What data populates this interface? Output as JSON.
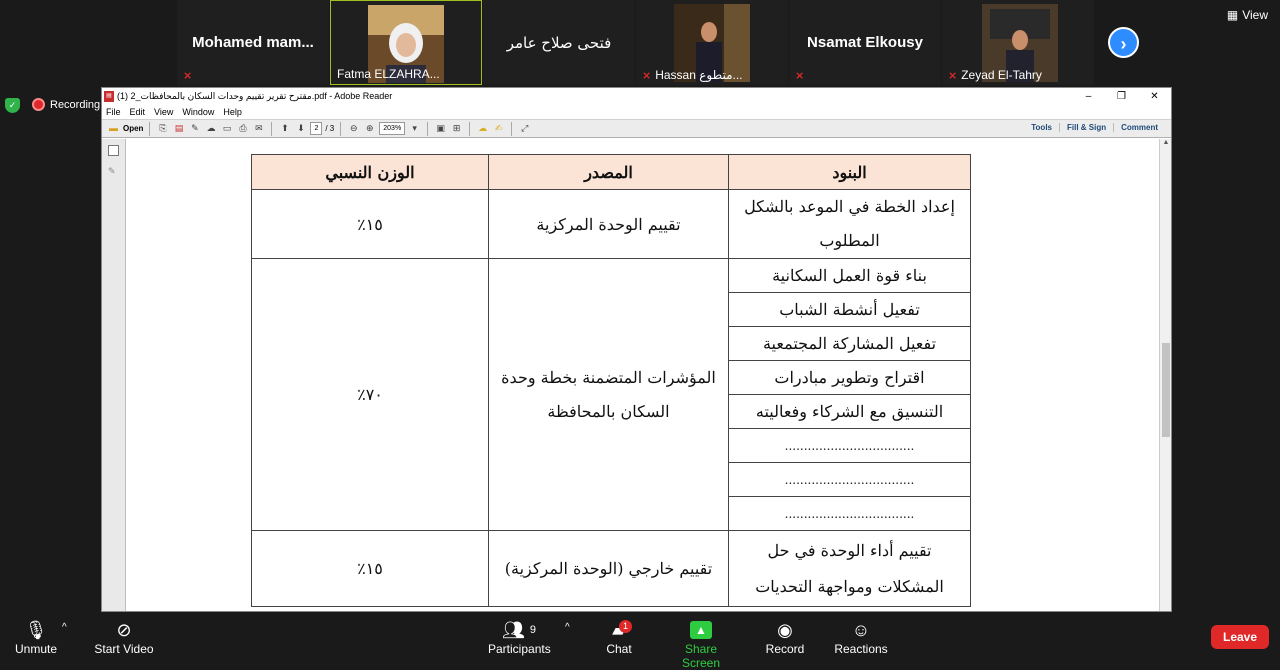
{
  "participants": [
    {
      "name": "Mohamed  mam...",
      "muted": true
    },
    {
      "name": "",
      "caption": "Fatma ELZAHRA...",
      "active": true
    },
    {
      "name": "فتحى صلاح عامر",
      "muted": false
    },
    {
      "name": "",
      "caption": "Hassan متطوع...",
      "muted": true
    },
    {
      "name": "Nsamat Elkousy",
      "muted": true
    },
    {
      "name": "",
      "caption": "Zeyad El-Tahry",
      "muted": true
    }
  ],
  "view_label": "View",
  "recording_label": "Recording",
  "window": {
    "title": "مقترح تقرير تقييم وحدات السكان بالمحافظات_2 (1).pdf - Adobe Reader",
    "menu": [
      "File",
      "Edit",
      "View",
      "Window",
      "Help"
    ],
    "open_label": "Open",
    "page_current": "2",
    "page_total": "/ 3",
    "zoom": "203%",
    "right_tools": [
      "Tools",
      "Fill & Sign",
      "Comment"
    ]
  },
  "table": {
    "headers": {
      "items": "البنود",
      "source": "المصدر",
      "weight": "الوزن النسبي"
    },
    "row1": {
      "items": [
        "إعداد الخطة في الموعد بالشكل",
        "المطلوب"
      ],
      "source": "تقييم الوحدة المركزية",
      "weight": "١٥٪"
    },
    "row2": {
      "items": [
        "بناء قوة العمل السكانية",
        "تفعيل أنشطة الشباب",
        "تفعيل المشاركة المجتمعية",
        "اقتراح وتطوير مبادرات",
        "التنسيق مع الشركاء وفعاليته",
        "..................................",
        "..................................",
        ".................................."
      ],
      "source": [
        "المؤشرات المتضمنة بخطة وحدة",
        "السكان بالمحافظة"
      ],
      "weight": "٧٠٪"
    },
    "row3": {
      "items": [
        "تقييم أداء الوحدة في حل",
        "المشكلات ومواجهة التحديات"
      ],
      "source": "تقييم خارجي (الوحدة المركزية)",
      "weight": "١٥٪"
    }
  },
  "bottom": {
    "unmute": "Unmute",
    "start_video": "Start Video",
    "participants": "Participants",
    "participants_count": "9",
    "chat": "Chat",
    "chat_badge": "1",
    "share": "Share Screen",
    "record": "Record",
    "reactions": "Reactions",
    "leave": "Leave"
  },
  "colors": {
    "accent": "#2d8cff",
    "share": "#2ecc40",
    "leave": "#e02828",
    "header_fill": "#fbe3d6"
  }
}
